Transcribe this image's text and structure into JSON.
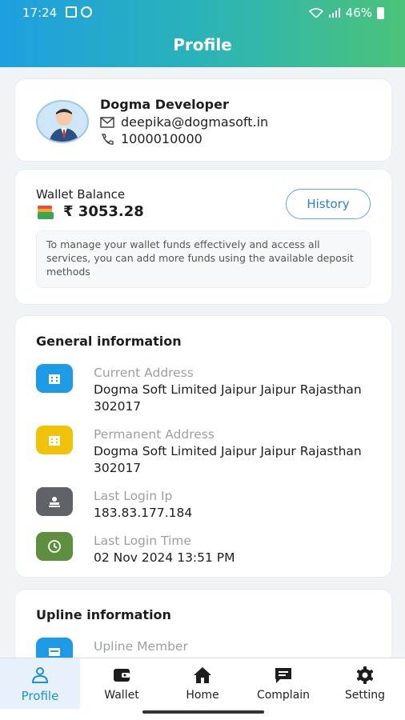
{
  "status": {
    "time": "17:24",
    "battery": "46%"
  },
  "header": {
    "title": "Profile"
  },
  "profile": {
    "name": "Dogma Developer",
    "email": "deepika@dogmasoft.in",
    "phone": "1000010000"
  },
  "wallet": {
    "label": "Wallet Balance",
    "amount": "₹ 3053.28",
    "history_label": "History",
    "note": "To manage your wallet funds effectively and access all services, you can add more funds using the available deposit methods"
  },
  "general": {
    "title": "General information",
    "items": [
      {
        "label": "Current Address",
        "value": "Dogma Soft Limited Jaipur Jaipur Rajasthan  302017",
        "icon": "building-icon",
        "color": "#1e9be6"
      },
      {
        "label": "Permanent Address",
        "value": "Dogma Soft Limited Jaipur Jaipur Rajasthan  302017",
        "icon": "building-icon",
        "color": "#f0c20a"
      },
      {
        "label": "Last Login Ip",
        "value": "183.83.177.184",
        "icon": "stamp-icon",
        "color": "#5f6368"
      },
      {
        "label": "Last Login Time",
        "value": "02 Nov 2024 13:51 PM",
        "icon": "clock-icon",
        "color": "#5e8f3e"
      }
    ]
  },
  "upline": {
    "title": "Upline information",
    "member_label": "Upline Member"
  },
  "nav": [
    {
      "label": "Profile",
      "icon": "person-icon",
      "active": true
    },
    {
      "label": "Wallet",
      "icon": "wallet-icon",
      "active": false
    },
    {
      "label": "Home",
      "icon": "home-icon",
      "active": false
    },
    {
      "label": "Complain",
      "icon": "chat-icon",
      "active": false
    },
    {
      "label": "Setting",
      "icon": "gear-icon",
      "active": false
    }
  ],
  "colors": {
    "accent": "#1e8fdc",
    "gradient_start": "#1e9fe0",
    "gradient_end": "#4bc37a"
  }
}
